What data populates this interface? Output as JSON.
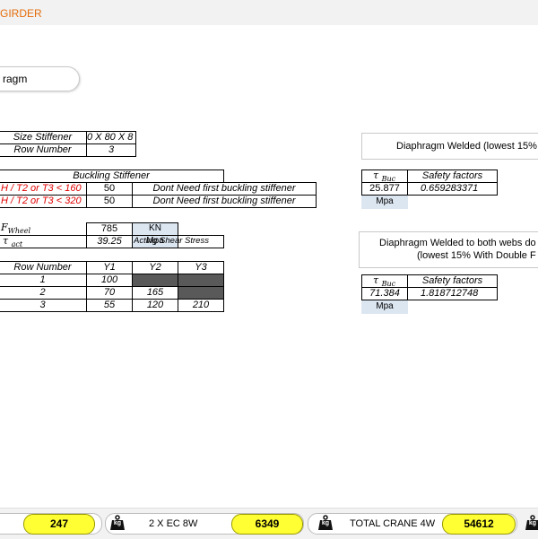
{
  "header": {
    "title": "GIRDER"
  },
  "pill": {
    "label": "ragm"
  },
  "stiffener": {
    "size_label": "Size Stiffener",
    "size_value": "0 X 80 X 8",
    "row_label": "Row Number",
    "row_value": "3"
  },
  "buckling": {
    "header": "Buckling Stiffener",
    "rows": [
      {
        "cond": "H / T2 or T3  < 160",
        "limit": "50",
        "msg": "Dont Need first buckling stiffener"
      },
      {
        "cond": "H / T2 or T3  < 320",
        "limit": "50",
        "msg": "Dont Need first buckling stiffener"
      }
    ]
  },
  "loads": {
    "fwheel_symbol": "F",
    "fwheel_sub": "Wheel",
    "fwheel_value": "785",
    "fwheel_unit": "KN",
    "tau_symbol": "τ",
    "tau_sub": "act",
    "tau_value": "39.25",
    "tau_unit": "Mpa",
    "tau_desc": "Acting Shear Stress"
  },
  "ytable": {
    "headers": [
      "Row Number",
      "Y1",
      "Y2",
      "Y3"
    ],
    "rows": [
      {
        "n": "1",
        "y1": "100",
        "y2": "",
        "y3": ""
      },
      {
        "n": "2",
        "y1": "70",
        "y2": "165",
        "y3": ""
      },
      {
        "n": "3",
        "y1": "55",
        "y2": "120",
        "y3": "210"
      }
    ]
  },
  "panel1": {
    "title": "Diaphragm Welded  (lowest 15%",
    "tau_symbol": "τ",
    "tau_sub": "Buc",
    "sf_label": "Safety factors",
    "tau_value": "25.877",
    "sf_value": "0.659283371",
    "unit": "Mpa"
  },
  "panel2": {
    "title_line1": "Diaphragm Welded to both webs do",
    "title_line2": "(lowest 15% With Double F",
    "tau_symbol": "τ",
    "tau_sub": "Buc",
    "sf_label": "Safety factors",
    "tau_value": "71.384",
    "sf_value": "1.818712748",
    "unit": "Mpa"
  },
  "bottom": {
    "value1": "247",
    "kg_label": "kg",
    "label2": "2 X EC 8W",
    "value2": "6349",
    "label3": "TOTAL CRANE 4W",
    "value3": "54612"
  },
  "colors": {
    "title": "#e46c0a",
    "highlight": "#ffff33",
    "unit_cell": "#dce6f1",
    "dark_cell": "#595959",
    "warning_text": "#e00000"
  }
}
